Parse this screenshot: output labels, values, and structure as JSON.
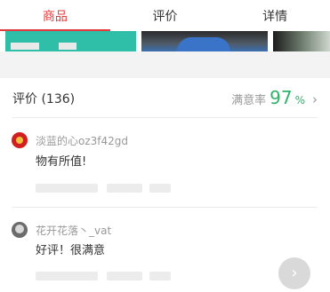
{
  "tabs": [
    {
      "label": "商品",
      "active": true
    },
    {
      "label": "评价",
      "active": false
    },
    {
      "label": "详情",
      "active": false
    }
  ],
  "reviews_section": {
    "title": "评价 (136)",
    "satisfaction_label": "满意率",
    "satisfaction_value": "97",
    "satisfaction_unit": "%"
  },
  "reviews": [
    {
      "username": "淡蓝的心oz3f42gd",
      "text": "物有所值!"
    },
    {
      "username": "花开花落丶_vat",
      "text": "好评！很满意"
    }
  ],
  "icons": {
    "chevron": "chevron-right-icon",
    "scroll_button": "arrow-right-icon"
  },
  "colors": {
    "accent": "#e4393c",
    "satisfaction": "#2fb26a"
  }
}
